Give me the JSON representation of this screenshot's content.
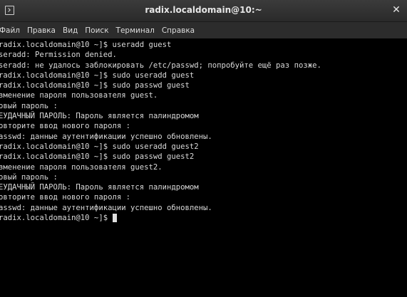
{
  "window": {
    "title": "radix.localdomain@10:~",
    "close_glyph": "✕",
    "icon": "terminal-icon"
  },
  "menu": {
    "items": [
      {
        "label": "Файл"
      },
      {
        "label": "Правка"
      },
      {
        "label": "Вид"
      },
      {
        "label": "Поиск"
      },
      {
        "label": "Терминал"
      },
      {
        "label": "Справка"
      }
    ]
  },
  "terminal": {
    "lines": [
      "radix.localdomain@10 ~]$ useradd guest",
      "seradd: Permission denied.",
      "seradd: не удалось заблокировать /etc/passwd; попробуйте ещё раз позже.",
      "radix.localdomain@10 ~]$ sudo useradd guest",
      "radix.localdomain@10 ~]$ sudo passwd guest",
      "зменение пароля пользователя guest.",
      "овый пароль :",
      "ЕУДАЧНЫЙ ПАРОЛЬ: Пароль является палиндромом",
      "овторите ввод нового пароля :",
      "asswd: данные аутентификации успешно обновлены.",
      "radix.localdomain@10 ~]$ sudo useradd guest2",
      "radix.localdomain@10 ~]$ sudo passwd guest2",
      "зменение пароля пользователя guest2.",
      "овый пароль :",
      "ЕУДАЧНЫЙ ПАРОЛЬ: Пароль является палиндромом",
      "овторите ввод нового пароля :",
      "asswd: данные аутентификации успешно обновлены."
    ],
    "prompt": "radix.localdomain@10 ~]$ "
  },
  "colors": {
    "background": "#000000",
    "text": "#d9d9d9",
    "titlebar": "#2f2f2f",
    "menubar": "#2c2c2c"
  }
}
